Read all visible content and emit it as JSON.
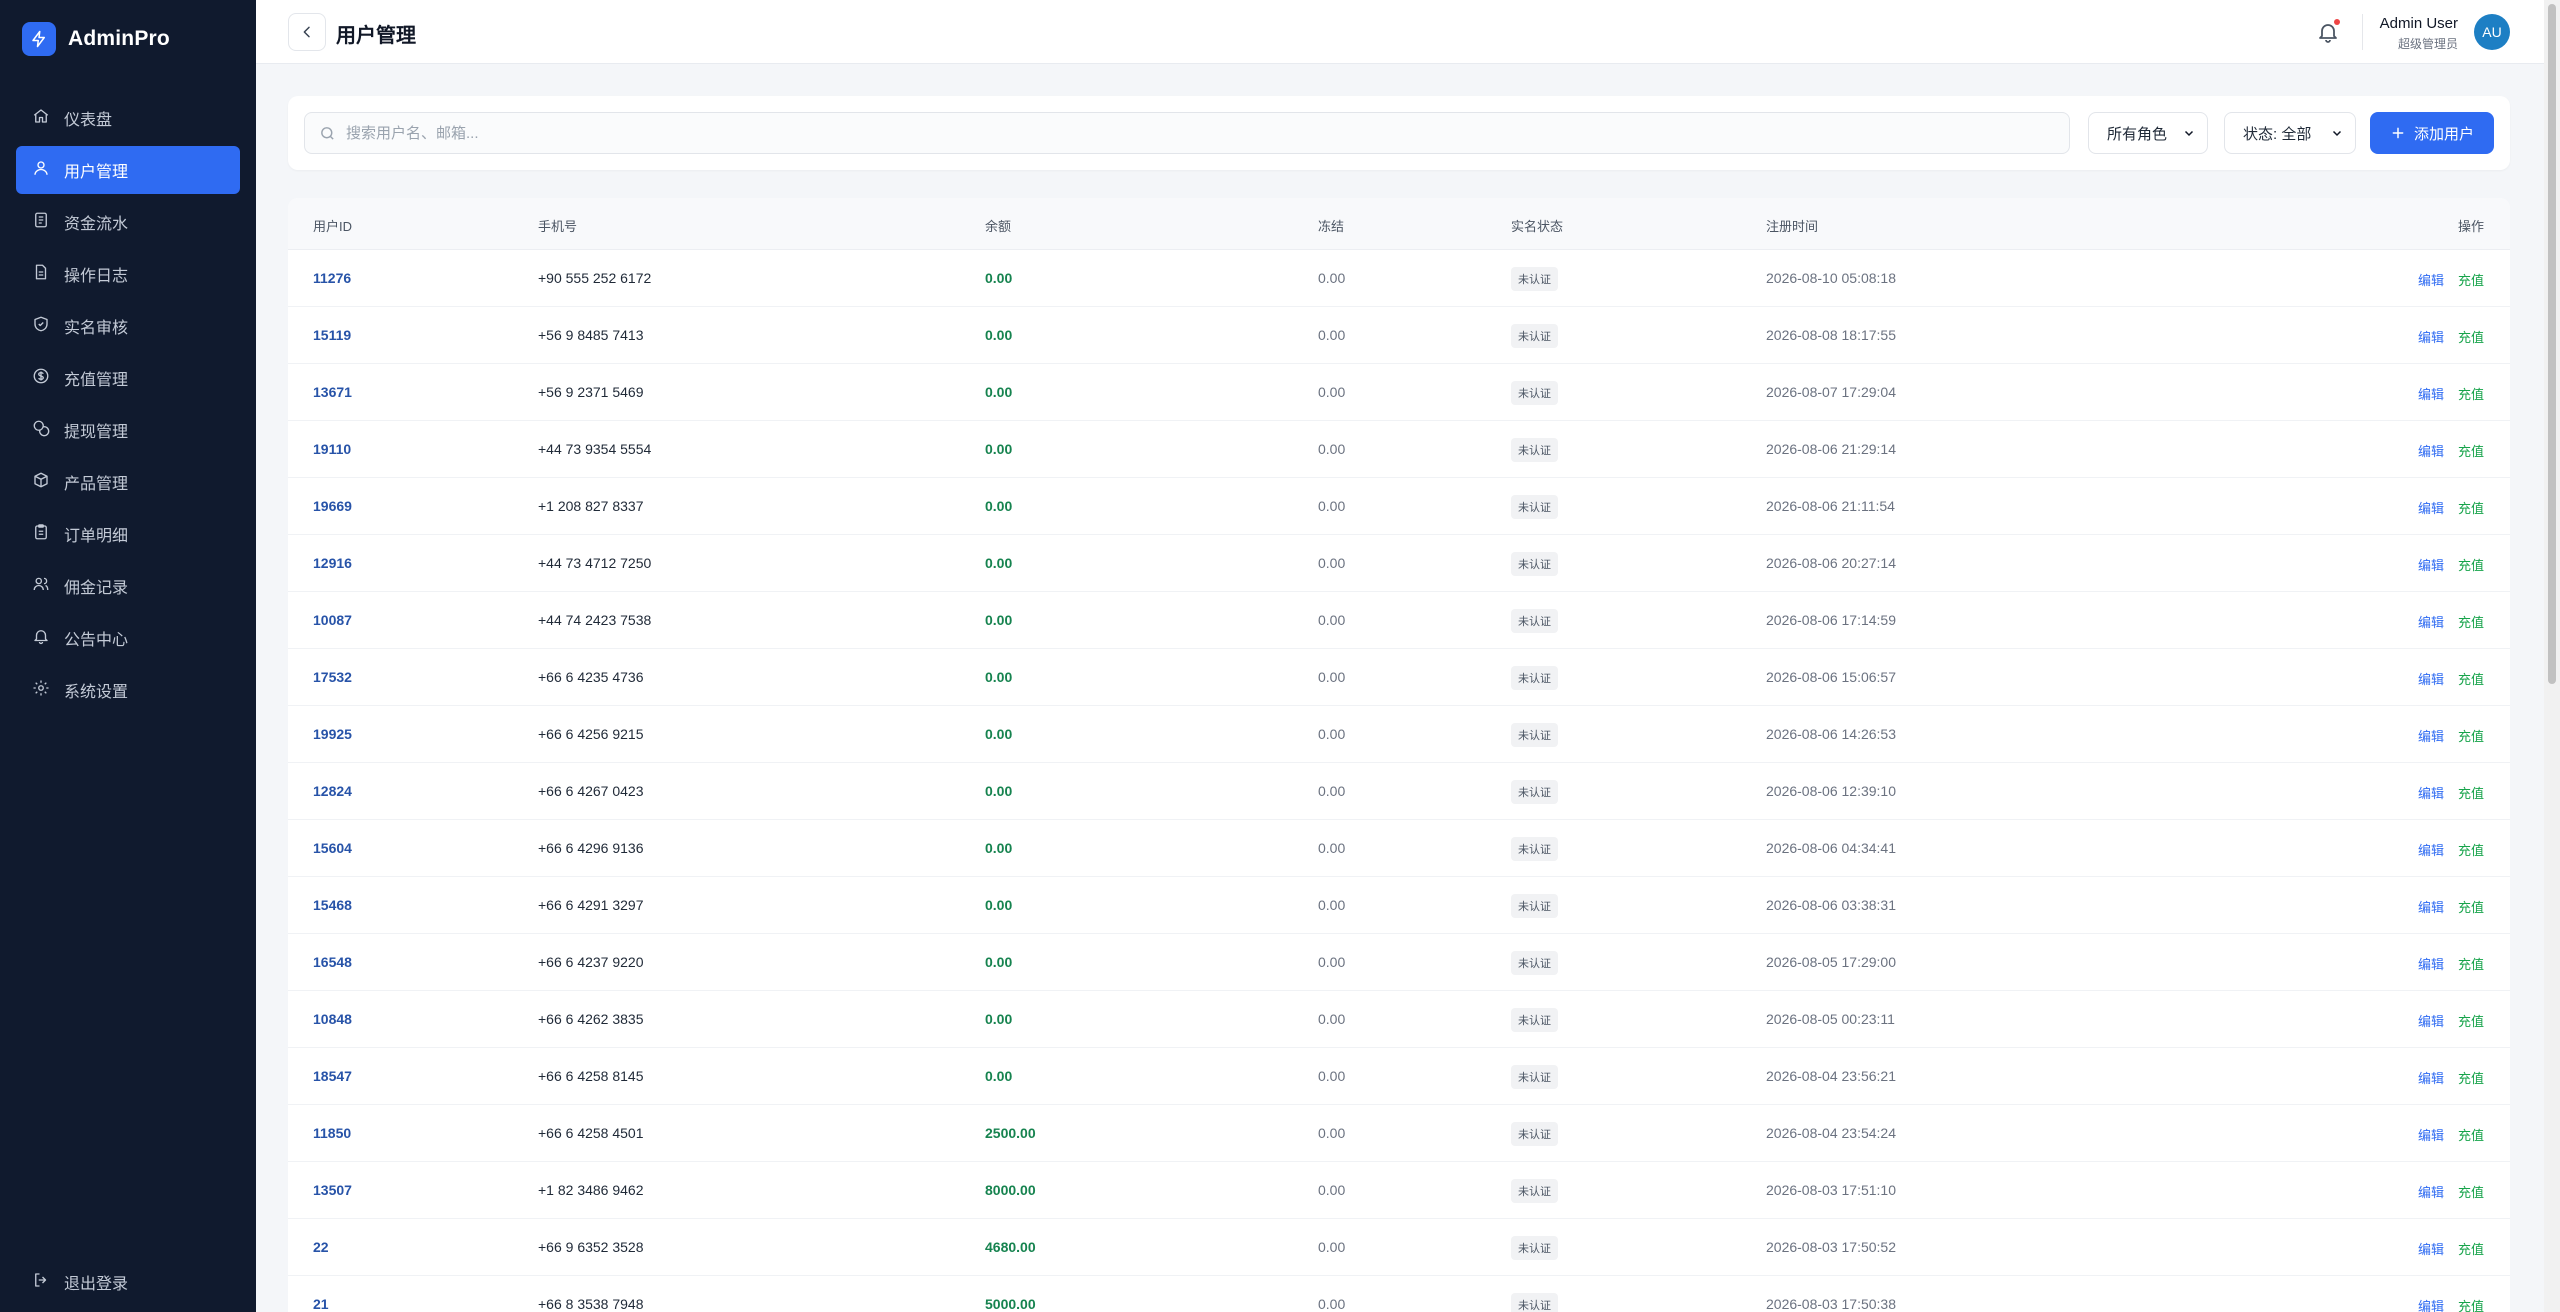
{
  "brand": {
    "name": "AdminPro"
  },
  "sidebar": {
    "items": [
      {
        "label": "仪表盘",
        "icon": "home-icon"
      },
      {
        "label": "用户管理",
        "icon": "users-icon",
        "active": true
      },
      {
        "label": "资金流水",
        "icon": "ledger-icon"
      },
      {
        "label": "操作日志",
        "icon": "file-icon"
      },
      {
        "label": "实名审核",
        "icon": "shield-icon"
      },
      {
        "label": "充值管理",
        "icon": "dollar-icon"
      },
      {
        "label": "提现管理",
        "icon": "coins-icon"
      },
      {
        "label": "产品管理",
        "icon": "box-icon"
      },
      {
        "label": "订单明细",
        "icon": "clipboard-icon"
      },
      {
        "label": "佣金记录",
        "icon": "user-group-icon"
      },
      {
        "label": "公告中心",
        "icon": "bell-icon"
      },
      {
        "label": "系统设置",
        "icon": "gear-icon"
      }
    ],
    "logout": "退出登录"
  },
  "header": {
    "title": "用户管理",
    "user_name": "Admin User",
    "user_role": "超级管理员",
    "avatar": "AU"
  },
  "filters": {
    "search_placeholder": "搜索用户名、邮箱...",
    "role_select": "所有角色",
    "status_select": "状态: 全部",
    "add_button": "添加用户"
  },
  "table": {
    "columns": [
      "用户ID",
      "手机号",
      "余额",
      "冻结",
      "实名状态",
      "注册时间",
      "操作"
    ],
    "actions": {
      "edit": "编辑",
      "recharge": "充值"
    },
    "rows": [
      {
        "id": "11276",
        "phone": "+90 555 252 6172",
        "balance": "0.00",
        "frozen": "0.00",
        "kyc": "未认证",
        "time": "2026-08-10 05:08:18"
      },
      {
        "id": "15119",
        "phone": "+56 9 8485 7413",
        "balance": "0.00",
        "frozen": "0.00",
        "kyc": "未认证",
        "time": "2026-08-08 18:17:55"
      },
      {
        "id": "13671",
        "phone": "+56 9 2371 5469",
        "balance": "0.00",
        "frozen": "0.00",
        "kyc": "未认证",
        "time": "2026-08-07 17:29:04"
      },
      {
        "id": "19110",
        "phone": "+44 73 9354 5554",
        "balance": "0.00",
        "frozen": "0.00",
        "kyc": "未认证",
        "time": "2026-08-06 21:29:14"
      },
      {
        "id": "19669",
        "phone": "+1 208 827 8337",
        "balance": "0.00",
        "frozen": "0.00",
        "kyc": "未认证",
        "time": "2026-08-06 21:11:54"
      },
      {
        "id": "12916",
        "phone": "+44 73 4712 7250",
        "balance": "0.00",
        "frozen": "0.00",
        "kyc": "未认证",
        "time": "2026-08-06 20:27:14"
      },
      {
        "id": "10087",
        "phone": "+44 74 2423 7538",
        "balance": "0.00",
        "frozen": "0.00",
        "kyc": "未认证",
        "time": "2026-08-06 17:14:59"
      },
      {
        "id": "17532",
        "phone": "+66 6 4235 4736",
        "balance": "0.00",
        "frozen": "0.00",
        "kyc": "未认证",
        "time": "2026-08-06 15:06:57"
      },
      {
        "id": "19925",
        "phone": "+66 6 4256 9215",
        "balance": "0.00",
        "frozen": "0.00",
        "kyc": "未认证",
        "time": "2026-08-06 14:26:53"
      },
      {
        "id": "12824",
        "phone": "+66 6 4267 0423",
        "balance": "0.00",
        "frozen": "0.00",
        "kyc": "未认证",
        "time": "2026-08-06 12:39:10"
      },
      {
        "id": "15604",
        "phone": "+66 6 4296 9136",
        "balance": "0.00",
        "frozen": "0.00",
        "kyc": "未认证",
        "time": "2026-08-06 04:34:41"
      },
      {
        "id": "15468",
        "phone": "+66 6 4291 3297",
        "balance": "0.00",
        "frozen": "0.00",
        "kyc": "未认证",
        "time": "2026-08-06 03:38:31"
      },
      {
        "id": "16548",
        "phone": "+66 6 4237 9220",
        "balance": "0.00",
        "frozen": "0.00",
        "kyc": "未认证",
        "time": "2026-08-05 17:29:00"
      },
      {
        "id": "10848",
        "phone": "+66 6 4262 3835",
        "balance": "0.00",
        "frozen": "0.00",
        "kyc": "未认证",
        "time": "2026-08-05 00:23:11"
      },
      {
        "id": "18547",
        "phone": "+66 6 4258 8145",
        "balance": "0.00",
        "frozen": "0.00",
        "kyc": "未认证",
        "time": "2026-08-04 23:56:21"
      },
      {
        "id": "11850",
        "phone": "+66 6 4258 4501",
        "balance": "2500.00",
        "frozen": "0.00",
        "kyc": "未认证",
        "time": "2026-08-04 23:54:24"
      },
      {
        "id": "13507",
        "phone": "+1 82 3486 9462",
        "balance": "8000.00",
        "frozen": "0.00",
        "kyc": "未认证",
        "time": "2026-08-03 17:51:10"
      },
      {
        "id": "22",
        "phone": "+66 9 6352 3528",
        "balance": "4680.00",
        "frozen": "0.00",
        "kyc": "未认证",
        "time": "2026-08-03 17:50:52"
      },
      {
        "id": "21",
        "phone": "+66 8 3538 7948",
        "balance": "5000.00",
        "frozen": "0.00",
        "kyc": "未认证",
        "time": "2026-08-03 17:50:38"
      }
    ]
  }
}
